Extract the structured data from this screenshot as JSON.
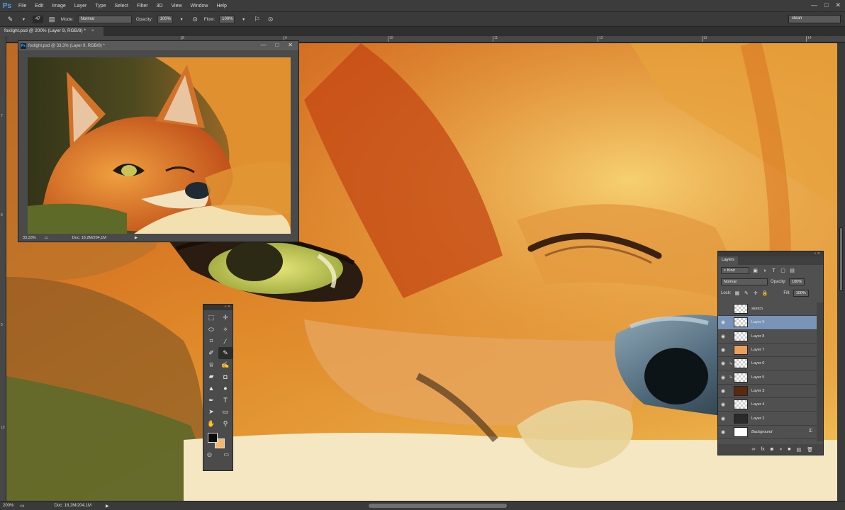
{
  "app": {
    "logo": "Ps"
  },
  "menu": [
    "File",
    "Edit",
    "Image",
    "Layer",
    "Type",
    "Select",
    "Filter",
    "3D",
    "View",
    "Window",
    "Help"
  ],
  "window_controls": {
    "minimize": "—",
    "maximize": "□",
    "close": "✕"
  },
  "options": {
    "brush_size": "47",
    "mode_label": "Mode:",
    "mode_value": "Normal",
    "opacity_label": "Opacity:",
    "opacity_value": "100%",
    "flow_label": "Flow:",
    "flow_value": "100%",
    "workspace": "clean"
  },
  "document_tab": {
    "title": "foxlight.psd @ 200% (Layer 9, RGB/8) *",
    "close": "×"
  },
  "ruler": {
    "top_ticks": [
      "8",
      "9",
      "10",
      "11",
      "12",
      "13",
      "14"
    ],
    "left_ticks": [
      "7",
      "8",
      "9",
      "10"
    ]
  },
  "floating_window": {
    "title": "foxlight.psd @ 33,3% (Layer 9, RGB/8) *",
    "zoom": "33,33%",
    "doc": "Doc: 18,2M/204,1M"
  },
  "status": {
    "zoom": "200%",
    "doc": "Doc: 18,2M/204,1M"
  },
  "tools": [
    {
      "icon": "marquee-icon",
      "glyph": "⬚"
    },
    {
      "icon": "move-icon",
      "glyph": "✛"
    },
    {
      "icon": "lasso-icon",
      "glyph": "⬭"
    },
    {
      "icon": "magic-wand-icon",
      "glyph": "✧"
    },
    {
      "icon": "crop-icon",
      "glyph": "⌗"
    },
    {
      "icon": "eyedropper-icon",
      "glyph": "⁄"
    },
    {
      "icon": "healing-brush-icon",
      "glyph": "✐"
    },
    {
      "icon": "brush-icon",
      "glyph": "✎"
    },
    {
      "icon": "clone-stamp-icon",
      "glyph": "♕"
    },
    {
      "icon": "history-brush-icon",
      "glyph": "✍"
    },
    {
      "icon": "eraser-icon",
      "glyph": "▰"
    },
    {
      "icon": "paint-bucket-icon",
      "glyph": "◘"
    },
    {
      "icon": "blur-icon",
      "glyph": "▲"
    },
    {
      "icon": "dodge-icon",
      "glyph": "●"
    },
    {
      "icon": "pen-icon",
      "glyph": "✒"
    },
    {
      "icon": "type-icon",
      "glyph": "T"
    },
    {
      "icon": "path-select-icon",
      "glyph": "➤"
    },
    {
      "icon": "shape-icon",
      "glyph": "▭"
    },
    {
      "icon": "hand-icon",
      "glyph": "✋"
    },
    {
      "icon": "zoom-icon",
      "glyph": "⚲"
    }
  ],
  "layers_panel": {
    "tab": "Layers",
    "kind": "Kind",
    "blend_mode": "Normal",
    "opacity_label": "Opacity:",
    "opacity_value": "100%",
    "lock_label": "Lock:",
    "fill_label": "Fill:",
    "fill_value": "100%",
    "layers": [
      {
        "name": "sketch",
        "visible": false,
        "selected": false,
        "clipped": false,
        "thumb": "checker",
        "locked": false
      },
      {
        "name": "Layer 9",
        "visible": true,
        "selected": true,
        "clipped": false,
        "thumb": "checker",
        "locked": false
      },
      {
        "name": "Layer 8",
        "visible": true,
        "selected": false,
        "clipped": false,
        "thumb": "checker",
        "locked": false
      },
      {
        "name": "Layer 7",
        "visible": true,
        "selected": false,
        "clipped": false,
        "thumb": "fox",
        "locked": false
      },
      {
        "name": "Layer 6",
        "visible": true,
        "selected": false,
        "clipped": true,
        "thumb": "checker",
        "locked": false
      },
      {
        "name": "Layer 5",
        "visible": true,
        "selected": false,
        "clipped": true,
        "thumb": "checker",
        "locked": false
      },
      {
        "name": "Layer 3",
        "visible": true,
        "selected": false,
        "clipped": false,
        "thumb": "dark-fox",
        "locked": false
      },
      {
        "name": "Layer 4",
        "visible": true,
        "selected": false,
        "clipped": false,
        "thumb": "checker",
        "locked": false
      },
      {
        "name": "Layer 2",
        "visible": true,
        "selected": false,
        "clipped": false,
        "thumb": "dark",
        "locked": false
      },
      {
        "name": "Background",
        "visible": true,
        "selected": false,
        "clipped": false,
        "thumb": "white",
        "locked": true
      }
    ]
  }
}
